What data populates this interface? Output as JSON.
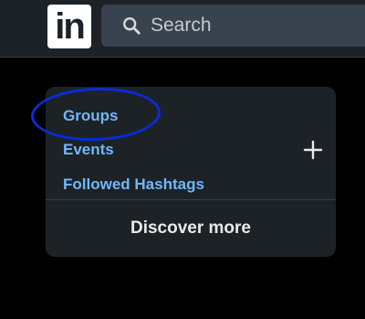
{
  "header": {
    "logo_text": "in",
    "search": {
      "placeholder": "Search",
      "icon": "search-icon"
    }
  },
  "panel": {
    "links": [
      {
        "label": "Groups"
      },
      {
        "label": "Events"
      },
      {
        "label": "Followed Hashtags"
      }
    ],
    "add_icon": "plus-icon",
    "discover_label": "Discover more"
  },
  "colors": {
    "background": "#000000",
    "surface": "#1d2226",
    "search_bg": "#38434f",
    "link": "#71b7fb",
    "text_primary": "#e9e9ea",
    "annotation": "#0a2bd8"
  }
}
